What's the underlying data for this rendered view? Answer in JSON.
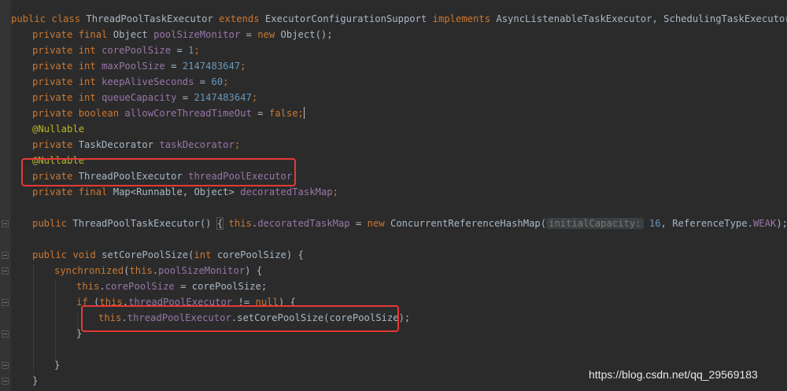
{
  "code": {
    "class_decl": {
      "kw1": "public class ",
      "name": "ThreadPoolTaskExecutor ",
      "kw2": "extends ",
      "parent": "ExecutorConfigurationSupport ",
      "kw3": "implements ",
      "ifaces": "AsyncListenableTaskExecutor, SchedulingTaskExecutor {"
    },
    "l1": {
      "kw": "private final ",
      "type": "Object ",
      "name": "poolSizeMonitor",
      "op": " = ",
      "kw2": "new ",
      "rest": "Object();"
    },
    "l2": {
      "kw": "private int ",
      "name": "corePoolSize",
      "op": " = ",
      "num": "1",
      "end": ";"
    },
    "l3": {
      "kw": "private int ",
      "name": "maxPoolSize",
      "op": " = ",
      "num": "2147483647",
      "end": ";"
    },
    "l4": {
      "kw": "private int ",
      "name": "keepAliveSeconds",
      "op": " = ",
      "num": "60",
      "end": ";"
    },
    "l5": {
      "kw": "private int ",
      "name": "queueCapacity",
      "op": " = ",
      "num": "2147483647",
      "end": ";"
    },
    "l6": {
      "kw": "private boolean ",
      "name": "allowCoreThreadTimeOut",
      "op": " = ",
      "kw2": "false",
      "end": ";"
    },
    "l7": {
      "ann": "@Nullable"
    },
    "l8": {
      "kw": "private ",
      "type": "TaskDecorator ",
      "name": "taskDecorator",
      "end": ";"
    },
    "l9": {
      "ann": "@Nullable"
    },
    "l10": {
      "kw": "private ",
      "type": "ThreadPoolExecutor ",
      "name": "threadPoolExecutor",
      "end": ";"
    },
    "l11": {
      "kw": "private final ",
      "type": "Map<Runnable, Object> ",
      "name": "decoratedTaskMap",
      "end": ";"
    },
    "l12": {
      "kw": "public ",
      "name": "ThreadPoolTaskExecutor",
      "p": "() ",
      "open": "{",
      "sp": " ",
      "this": "this",
      "dot": ".",
      "fld": "decoratedTaskMap",
      "op": " = ",
      "new": "new ",
      "call": "ConcurrentReferenceHashMap(",
      "hint": "initialCapacity:",
      "num": " 16",
      "rest": ", ReferenceType.",
      "weak": "WEAK",
      "end": ");",
      "close": " }"
    },
    "l13": {
      "kw": "public void ",
      "name": "setCorePoolSize",
      "p1": "(",
      "kw2": "int ",
      "p2": "corePoolSize) {"
    },
    "l14": {
      "kw": "synchronized",
      "p1": "(",
      "this": "this",
      "dot": ".",
      "fld": "poolSizeMonitor",
      "p2": ") {"
    },
    "l15": {
      "this": "this",
      "dot": ".",
      "fld": "corePoolSize",
      "rest": " = corePoolSize;"
    },
    "l16": {
      "kw": "if ",
      "p1": "(",
      "this": "this",
      "dot": ".",
      "fld": "threadPoolExecutor",
      "op": " != ",
      "null": "null",
      "p2": ") {"
    },
    "l17": {
      "this": "this",
      "dot": ".",
      "fld": "threadPoolExecutor",
      "rest": ".setCorePoolSize(corePoolSize);"
    },
    "l18": {
      "b": "}"
    },
    "l19": {
      "b": "}"
    },
    "l20": {
      "b": "}"
    }
  },
  "watermark": "https://blog.csdn.net/qq_29569183",
  "colors": {
    "background": "#2b2b2b",
    "keyword": "#cc7832",
    "number": "#6897bb",
    "annotation": "#bbb529",
    "field": "#9876aa",
    "highlight_box": "#e53935"
  }
}
